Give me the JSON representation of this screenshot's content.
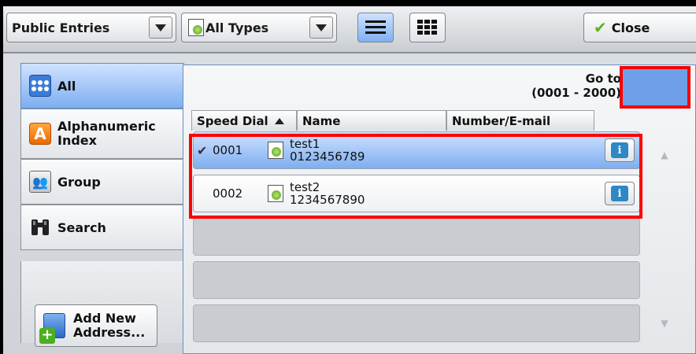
{
  "toolbar": {
    "entries_dropdown": "Public Entries",
    "types_dropdown": "All Types",
    "close_label": "Close"
  },
  "tabs": [
    {
      "label": "All",
      "selected": true,
      "icon": "address-grid-icon"
    },
    {
      "label_line1": "Alphanumeric",
      "label_line2": "Index",
      "icon": "letter-a-icon"
    },
    {
      "label": "Group",
      "icon": "group-icon"
    },
    {
      "label": "Search",
      "icon": "binoculars-icon"
    }
  ],
  "add_button": {
    "line1": "Add New",
    "line2": "Address..."
  },
  "goto": {
    "label": "Go to",
    "range": "(0001 - 2000)"
  },
  "columns": {
    "speed_dial": "Speed Dial",
    "name": "Name",
    "number_email": "Number/E-mail"
  },
  "rows": [
    {
      "selected": true,
      "speed_dial": "0001",
      "name": "test1",
      "number": "0123456789"
    },
    {
      "selected": false,
      "speed_dial": "0002",
      "name": "test2",
      "number": "1234567890"
    }
  ],
  "colors": {
    "accent": "#7eaef0",
    "highlight": "#ff0000"
  }
}
